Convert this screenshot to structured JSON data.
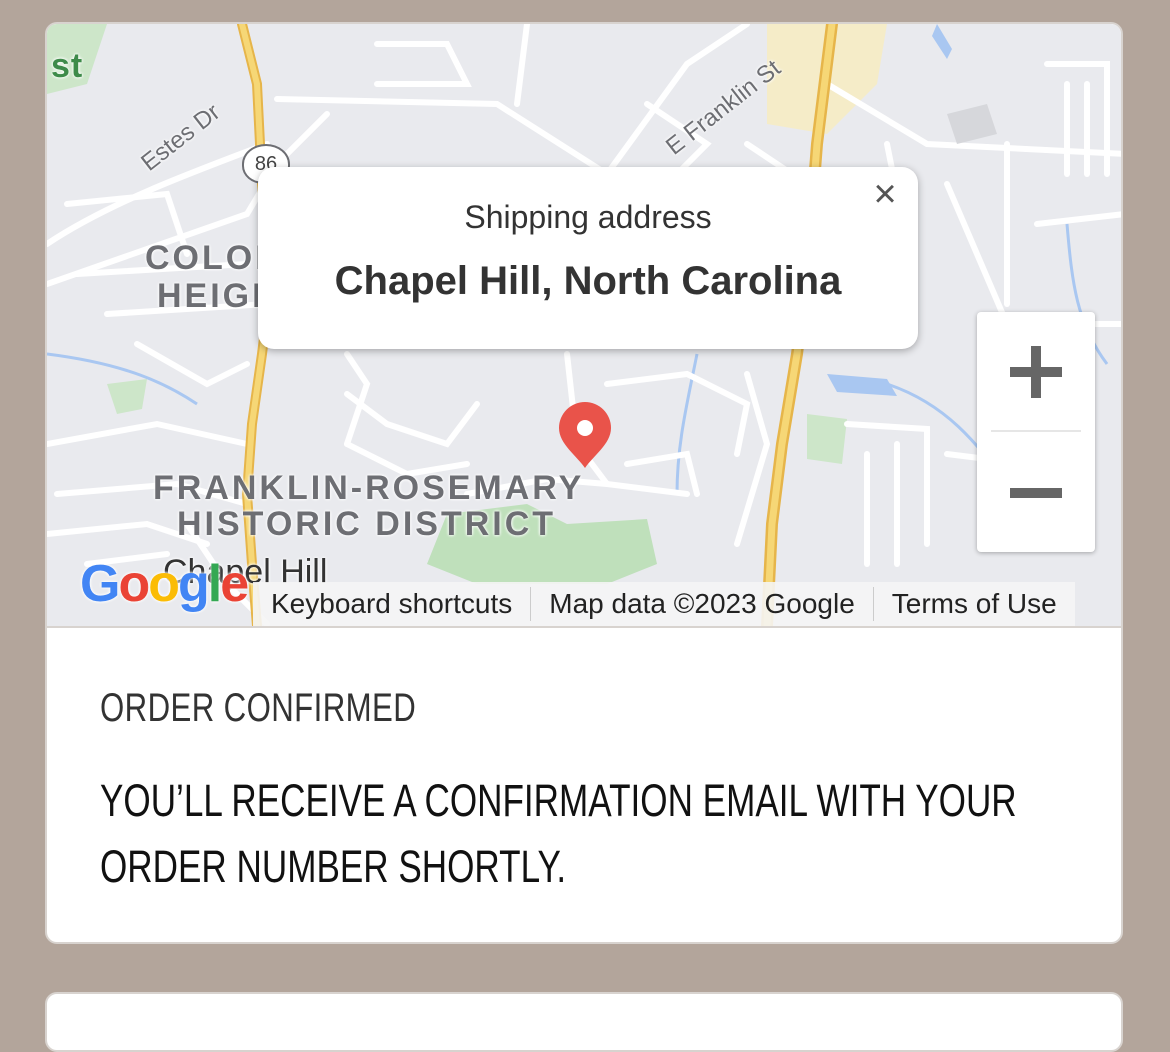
{
  "map": {
    "labels": {
      "colony_heights_1": "COLON",
      "colony_heights_2": "HEIGI",
      "district_1": "FRANKLIN-ROSEMARY",
      "district_2": "HISTORIC DISTRICT",
      "city": "Chapel Hill",
      "edge": "st"
    },
    "streets": {
      "estes": "Estes Dr",
      "franklin": "E Franklin St"
    },
    "route_shield": "86",
    "popup": {
      "title": "Shipping address",
      "text": "Chapel Hill, North Carolina",
      "close_icon": "×"
    },
    "zoom": {
      "in_icon": "plus-icon",
      "out_icon": "minus-icon"
    },
    "logo": {
      "text": "Google",
      "colors": [
        "#4285F4",
        "#EA4335",
        "#FBBC05",
        "#4285F4",
        "#34A853",
        "#EA4335"
      ]
    },
    "attribution": {
      "shortcuts": "Keyboard shortcuts",
      "map_data": "Map data ©2023 Google",
      "terms": "Terms of Use"
    },
    "marker_color": "#e9534a"
  },
  "confirmation": {
    "title": "ORDER CONFIRMED",
    "message": "YOU’LL RECEIVE A CONFIRMATION EMAIL WITH YOUR ORDER NUMBER SHORTLY."
  }
}
